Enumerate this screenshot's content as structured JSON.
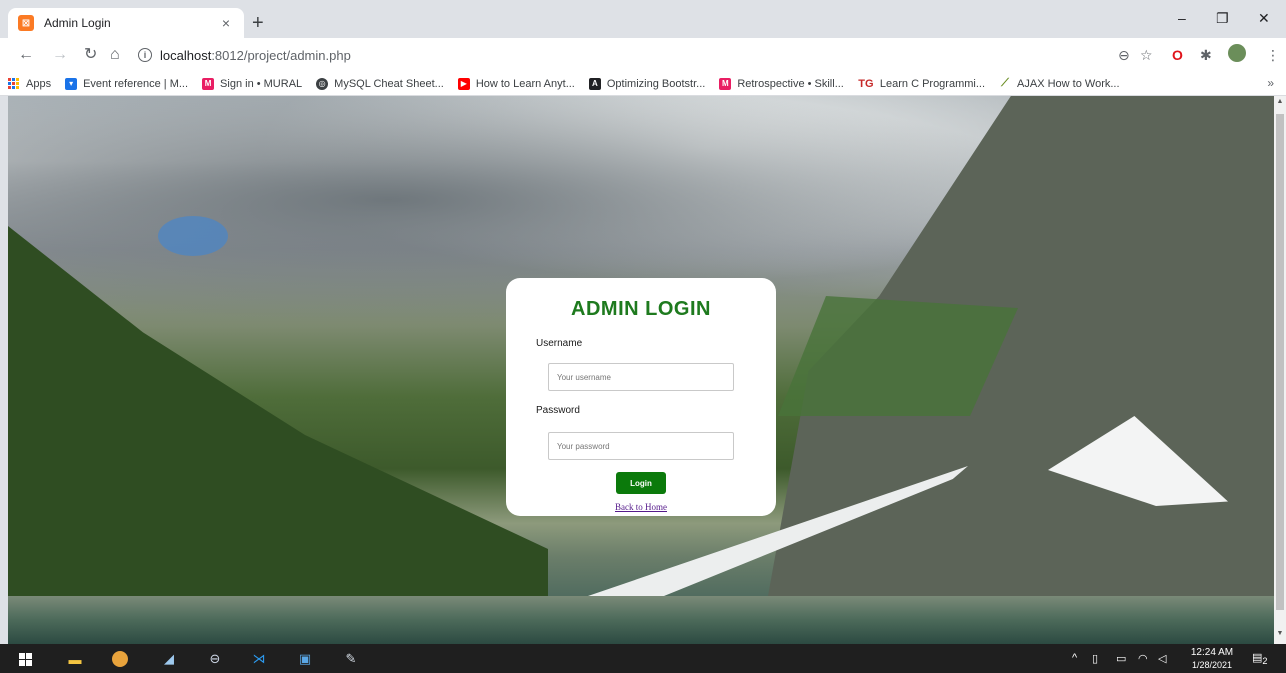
{
  "browser": {
    "tab_title": "Admin Login",
    "tab_close": "×",
    "new_tab": "+",
    "url_host": "localhost",
    "url_path": ":8012/project/admin.php",
    "window_controls": {
      "minimize": "–",
      "restore": "❐",
      "close": "✕"
    }
  },
  "bookmarks": {
    "apps_label": "Apps",
    "items": [
      {
        "label": "Event reference | M...",
        "icon_color": "#1a73e8"
      },
      {
        "label": "Sign in • MURAL",
        "icon_color": "#e91e63"
      },
      {
        "label": "MySQL Cheat Sheet...",
        "icon_color": "#3c4043"
      },
      {
        "label": "How to Learn Anyt...",
        "icon_color": "#ff0000"
      },
      {
        "label": "Optimizing Bootstr...",
        "icon_color": "#202124"
      },
      {
        "label": "Retrospective • Skill...",
        "icon_color": "#e91e63"
      },
      {
        "label": "Learn C Programmi...",
        "icon_color": "#c62828"
      },
      {
        "label": "AJAX How to Work...",
        "icon_color": "#6b8e23"
      }
    ],
    "more": "»"
  },
  "login": {
    "title": "ADMIN LOGIN",
    "username_label": "Username",
    "username_placeholder": "Your username",
    "password_label": "Password",
    "password_placeholder": "Your password",
    "button_label": "Login",
    "back_link": "Back to Home",
    "title_color": "#1e7a1e",
    "button_color": "#0b7a0b"
  },
  "taskbar": {
    "time": "12:24 AM",
    "date": "1/28/2021",
    "notifications": "2"
  }
}
